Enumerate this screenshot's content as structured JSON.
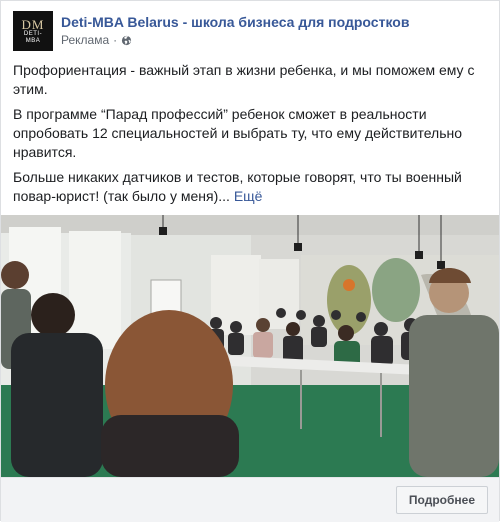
{
  "post": {
    "page_name": "Deti-MBA Belarus - школа бизнеса для подростков",
    "sponsored_label": "Реклама",
    "separator": "·",
    "logo_mark": "DM",
    "logo_text_1": "DETI-",
    "logo_text_2": "MBA",
    "paragraphs": [
      "Профориентация - важный этап в жизни ребенка, и мы поможем ему с этим.",
      "В программе “Парад профессий” ребенок сможет в реальности опробовать 12 специальностей и выбрать ту, что ему действительно нравится.",
      "Больше никаких датчиков и тестов, которые говорят, что ты военный повар-юрист! (так было у меня)..."
    ],
    "more_label": "Ещё",
    "cta_label": "Подробнее"
  },
  "icons": {
    "globe": "globe-icon"
  },
  "colors": {
    "link": "#385898",
    "logo_bg": "#111111",
    "footer_bg": "#f2f3f5"
  }
}
